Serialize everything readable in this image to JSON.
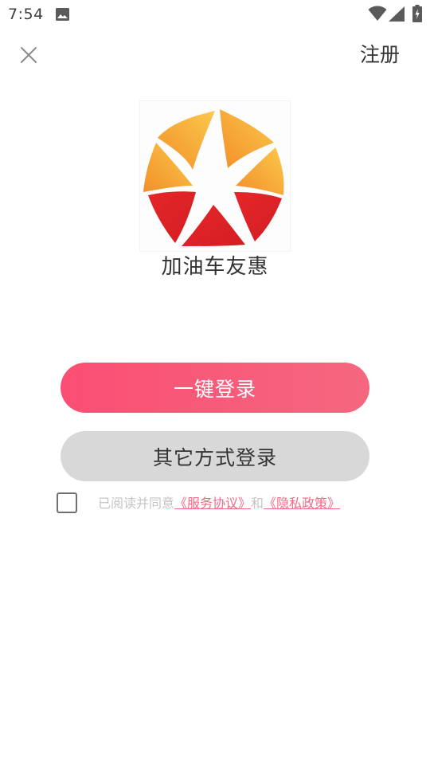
{
  "status_bar": {
    "time": "7:54",
    "icons": [
      "gallery-icon",
      "wifi-icon",
      "signal-icon",
      "battery-charging-icon"
    ]
  },
  "header": {
    "close_icon": "close-icon",
    "register_label": "注册"
  },
  "app": {
    "logo": "star-logo",
    "name": "加油车友惠",
    "logo_colors": [
      "#f7a234",
      "#fbc94a",
      "#e4262a"
    ]
  },
  "login": {
    "one_click_label": "一键登录",
    "other_methods_label": "其它方式登录"
  },
  "agreement": {
    "checked": false,
    "prefix": "已阅读并同意",
    "service_link": "《服务协议》",
    "and": "和",
    "privacy_link": "《隐私政策》"
  },
  "colors": {
    "primary_start": "#fb4e74",
    "primary_end": "#f5677f",
    "secondary_bg": "#d8d8d8",
    "link": "#f26a84"
  }
}
